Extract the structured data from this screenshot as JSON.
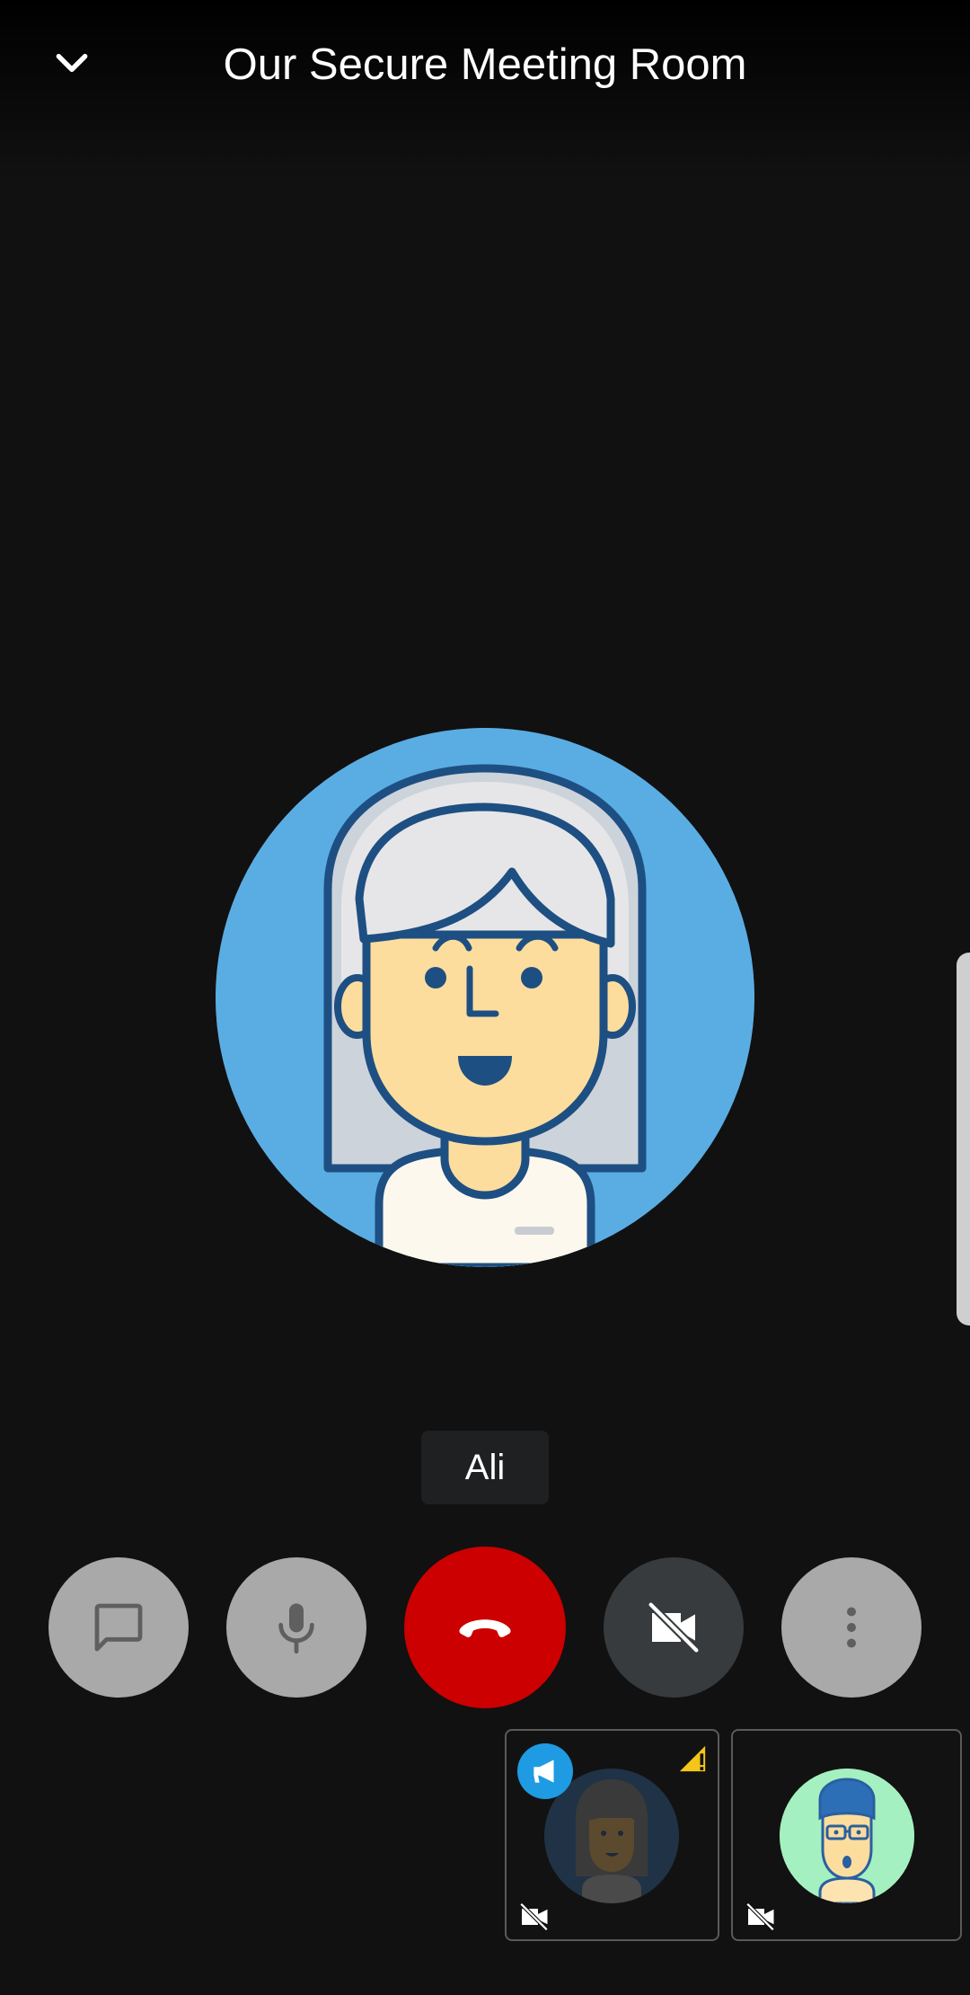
{
  "header": {
    "title": "Our Secure Meeting Room",
    "back_icon": "chevron-down-icon"
  },
  "active_speaker": {
    "name": "Ali",
    "avatar": "woman-gray-hair-avatar",
    "avatar_bg": "#5aade3"
  },
  "controls": [
    {
      "id": "chat",
      "icon": "chat-icon",
      "style": "light"
    },
    {
      "id": "microphone",
      "icon": "microphone-icon",
      "style": "light"
    },
    {
      "id": "end-call",
      "icon": "hang-up-icon",
      "style": "danger",
      "color": "#cc0000"
    },
    {
      "id": "camera",
      "icon": "video-off-icon",
      "style": "dark"
    },
    {
      "id": "more",
      "icon": "more-vertical-icon",
      "style": "light"
    }
  ],
  "participants": [
    {
      "avatar": "woman-dark-hair-avatar",
      "camera_off": true,
      "badges": [
        "megaphone-icon",
        "weak-signal-warning-icon"
      ],
      "badge_color": "#1e9be2",
      "warning_color": "#f5c518"
    },
    {
      "avatar": "man-glasses-avatar",
      "camera_off": true,
      "avatar_bg": "#a5f0c0"
    }
  ],
  "colors": {
    "background": "#111111",
    "end_call": "#cc0000",
    "control_light": "#a9a9a9",
    "control_dark": "#373b3d"
  }
}
